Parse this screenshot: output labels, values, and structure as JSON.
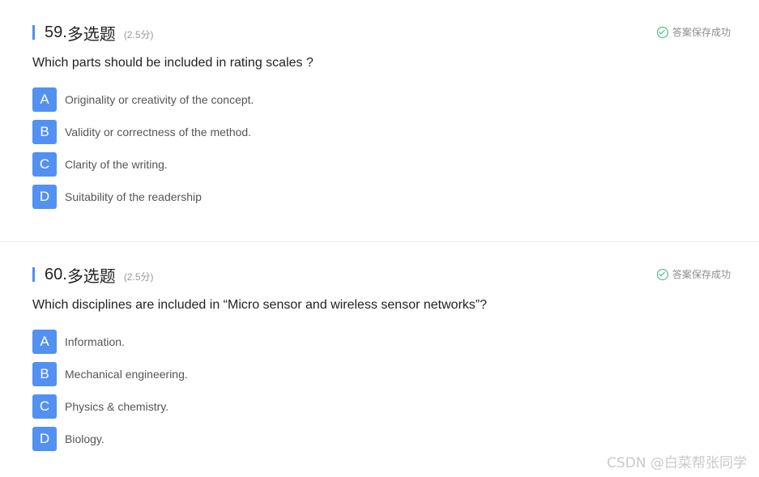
{
  "questions": [
    {
      "number": "59.",
      "type": "多选题",
      "score": "(2.5分)",
      "status": "答案保存成功",
      "text": "Which parts should be included in rating scales ?",
      "options": [
        {
          "letter": "A",
          "text": "Originality or creativity of the concept."
        },
        {
          "letter": "B",
          "text": "Validity or correctness of the method."
        },
        {
          "letter": "C",
          "text": "Clarity of the writing."
        },
        {
          "letter": "D",
          "text": "Suitability of the readership"
        }
      ]
    },
    {
      "number": "60.",
      "type": "多选题",
      "score": "(2.5分)",
      "status": "答案保存成功",
      "text": "Which disciplines are included in “Micro sensor and wireless sensor networks”?",
      "options": [
        {
          "letter": "A",
          "text": "Information."
        },
        {
          "letter": "B",
          "text": "Mechanical engineering."
        },
        {
          "letter": "C",
          "text": "Physics & chemistry."
        },
        {
          "letter": "D",
          "text": "Biology."
        }
      ]
    }
  ],
  "watermark": "CSDN @白菜帮张同学",
  "colors": {
    "accent": "#4e8ff0",
    "option_bg": "#5291f2",
    "saved_green": "#3bb47a"
  }
}
